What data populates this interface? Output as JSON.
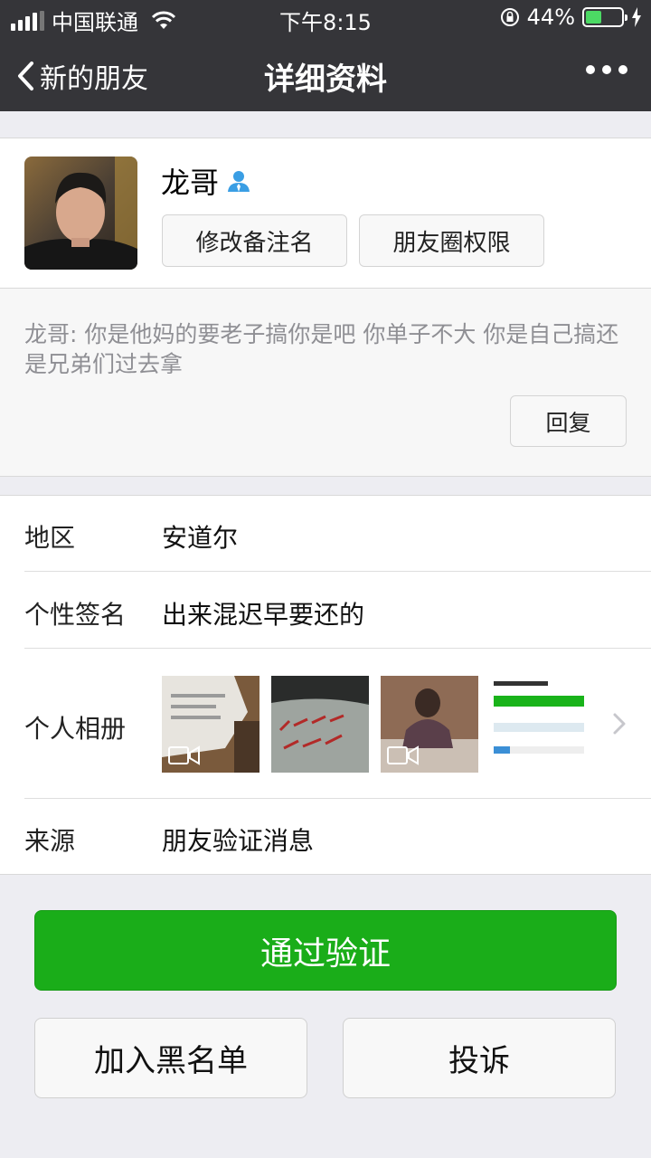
{
  "status_bar": {
    "carrier": "中国联通",
    "time": "下午8:15",
    "battery_percent": "44%",
    "battery_level": 0.44
  },
  "nav": {
    "back_label": "新的朋友",
    "title": "详细资料"
  },
  "profile": {
    "name": "龙哥",
    "buttons": {
      "edit_remark": "修改备注名",
      "moments_permission": "朋友圈权限"
    }
  },
  "message": {
    "text": "龙哥: 你是他妈的要老子搞你是吧 你单子不大 你是自己搞还是兄弟们过去拿",
    "reply_label": "回复"
  },
  "info": {
    "region": {
      "label": "地区",
      "value": "安道尔"
    },
    "signature": {
      "label": "个性签名",
      "value": "出来混迟早要还的"
    },
    "album": {
      "label": "个人相册"
    },
    "source": {
      "label": "来源",
      "value": "朋友验证消息"
    }
  },
  "actions": {
    "approve": "通过验证",
    "blacklist": "加入黑名单",
    "report": "投诉"
  },
  "colors": {
    "nav_bg": "#353539",
    "primary_green": "#1aad19",
    "page_bg": "#ededf2",
    "battery_green": "#4cd964"
  }
}
